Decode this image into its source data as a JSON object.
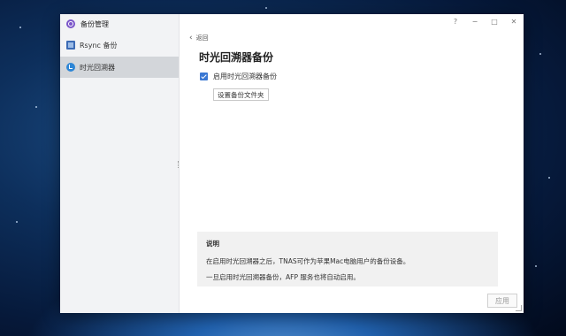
{
  "app": {
    "title": "备份管理"
  },
  "sidebar": {
    "items": [
      {
        "label": "Rsync 备份",
        "icon": "rsync-icon",
        "active": false
      },
      {
        "label": "时光回溯器",
        "icon": "time-machine-icon",
        "active": true
      }
    ]
  },
  "window_controls": {
    "help": "?",
    "minimize": "−",
    "maximize": "□",
    "close": "✕"
  },
  "main": {
    "back_label": "返回",
    "title": "时光回溯器备份",
    "enable_checkbox": {
      "label": "启用时光回溯器备份",
      "checked": true
    },
    "set_folder_button": "设置备份文件夹",
    "note": {
      "title": "说明",
      "lines": [
        "在启用时光回溯器之后，TNAS可作为苹果Mac电脑用户的备份设备。",
        "一旦启用时光回溯器备份，AFP 服务也将自动启用。"
      ]
    },
    "apply_button": "应用"
  },
  "colors": {
    "accent": "#3b78d3",
    "sidebar_bg": "#f2f3f5",
    "active_item": "#d3d6da"
  }
}
